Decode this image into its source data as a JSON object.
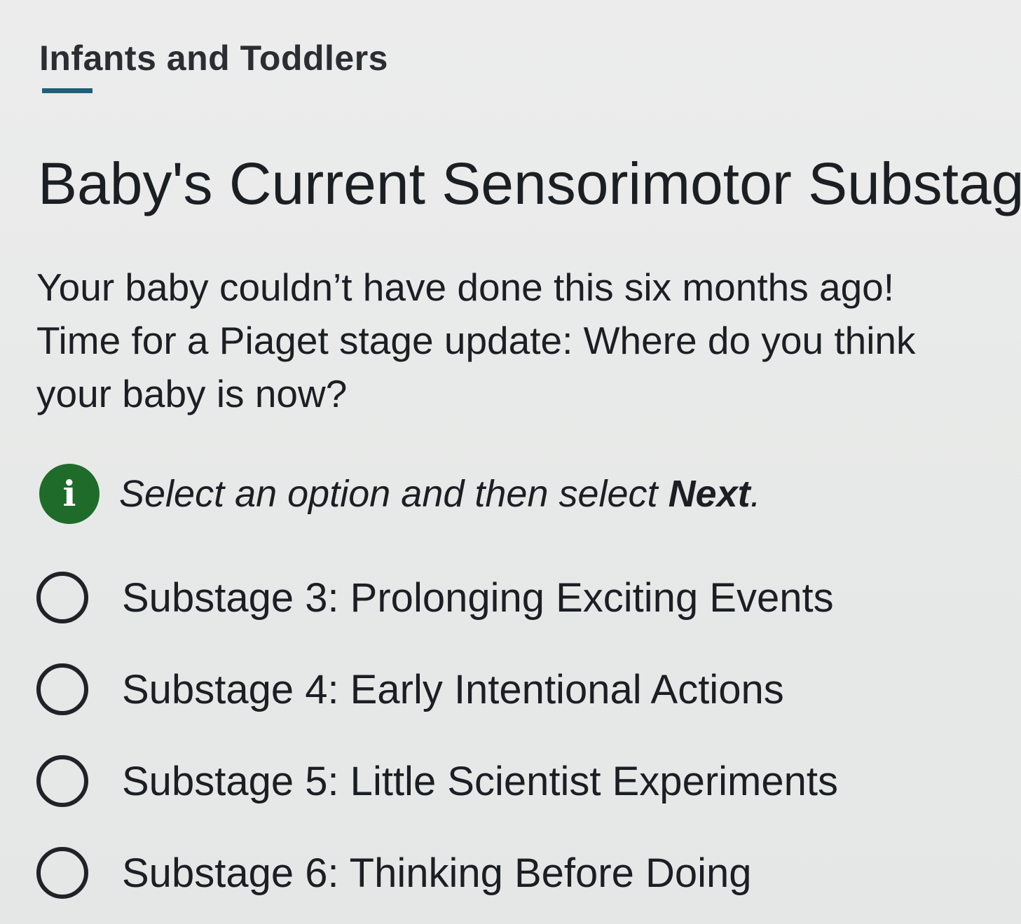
{
  "header": {
    "section_label": "Infants and Toddlers"
  },
  "main": {
    "title": "Baby's Current Sensorimotor Substage",
    "prompt": "Your baby couldn’t have done this six months ago! Time for a Piaget stage update: Where do you think your baby is now?",
    "instruction": {
      "icon": "info-icon",
      "icon_glyph": "i",
      "text_prefix": "Select an option and then select ",
      "text_emphasis": "Next",
      "text_suffix": "."
    },
    "options": [
      {
        "label": "Substage 3: Prolonging Exciting Events",
        "selected": false
      },
      {
        "label": "Substage 4: Early Intentional Actions",
        "selected": false
      },
      {
        "label": "Substage 5: Little Scientist Experiments",
        "selected": false
      },
      {
        "label": "Substage 6: Thinking Before Doing",
        "selected": false
      }
    ]
  },
  "colors": {
    "background": "#e8eaea",
    "accent_underline": "#1f5f78",
    "info_icon": "#1f6b2a",
    "text": "#1b1f24"
  }
}
